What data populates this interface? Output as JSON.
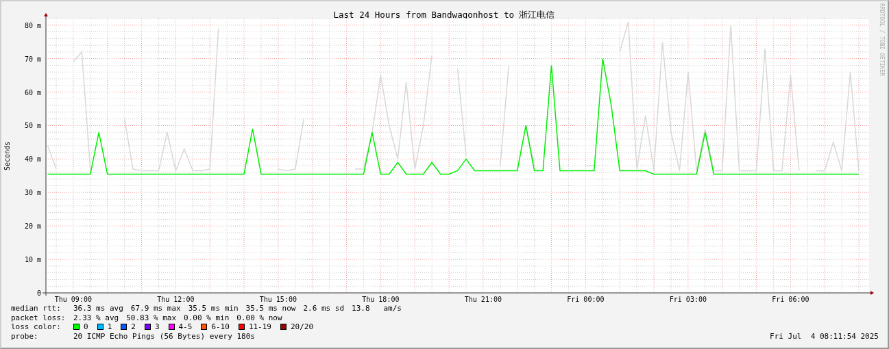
{
  "graph": {
    "title": "Last 24 Hours from Bandwagonhost to 浙江电信",
    "side_note": "RRDTOOL / TOBI OETIKER",
    "chart_data": {
      "type": "line",
      "ylabel": "Seconds",
      "ylim": [
        0,
        82
      ],
      "grid": true,
      "yticks": [
        {
          "value": 0,
          "label": "0"
        },
        {
          "value": 10,
          "label": "10 m"
        },
        {
          "value": 20,
          "label": "20 m"
        },
        {
          "value": 30,
          "label": "30 m"
        },
        {
          "value": 40,
          "label": "40 m"
        },
        {
          "value": 50,
          "label": "50 m"
        },
        {
          "value": 60,
          "label": "60 m"
        },
        {
          "value": 70,
          "label": "70 m"
        },
        {
          "value": 80,
          "label": "80 m"
        }
      ],
      "categories": [
        null,
        null,
        null,
        "Thu 09:00",
        null,
        null,
        null,
        null,
        null,
        null,
        null,
        null,
        null,
        null,
        null,
        "Thu 12:00",
        null,
        null,
        null,
        null,
        null,
        null,
        null,
        null,
        null,
        null,
        null,
        "Thu 15:00",
        null,
        null,
        null,
        null,
        null,
        null,
        null,
        null,
        null,
        null,
        null,
        "Thu 18:00",
        null,
        null,
        null,
        null,
        null,
        null,
        null,
        null,
        null,
        null,
        null,
        "Thu 21:00",
        null,
        null,
        null,
        null,
        null,
        null,
        null,
        null,
        null,
        null,
        null,
        "Fri 00:00",
        null,
        null,
        null,
        null,
        null,
        null,
        null,
        null,
        null,
        null,
        null,
        "Fri 03:00",
        null,
        null,
        null,
        null,
        null,
        null,
        null,
        null,
        null,
        null,
        null,
        "Fri 06:00",
        null,
        null,
        null,
        null,
        null,
        null,
        null,
        null
      ],
      "series": [
        {
          "color": "#d8d8d8",
          "values": [
            44,
            37,
            null,
            69,
            72,
            37,
            null,
            null,
            null,
            52,
            37,
            36.5,
            36.5,
            36.5,
            48,
            36.5,
            43,
            36.5,
            36.5,
            37,
            79,
            null,
            null,
            null,
            null,
            null,
            null,
            37,
            36.5,
            37,
            52,
            null,
            null,
            null,
            null,
            null,
            37,
            37,
            48,
            65,
            50,
            40,
            63,
            37,
            50,
            71,
            null,
            null,
            67,
            41,
            null,
            null,
            null,
            38,
            68,
            null,
            50,
            38,
            null,
            null,
            null,
            null,
            null,
            38,
            38,
            null,
            null,
            72,
            81,
            37,
            53,
            36.5,
            75,
            48,
            36.5,
            66,
            36.5,
            49,
            36.5,
            36.5,
            80,
            36.5,
            36.5,
            36.5,
            73,
            36.5,
            36.5,
            65,
            36.5,
            null,
            36.5,
            36.5,
            45,
            36.5,
            66,
            36.5
          ]
        },
        {
          "color": "#00ee00",
          "values": [
            35.5,
            35.5,
            35.5,
            35.5,
            35.5,
            35.5,
            48,
            35.5,
            35.5,
            35.5,
            35.5,
            35.5,
            35.5,
            35.5,
            35.5,
            35.5,
            35.5,
            35.5,
            35.5,
            35.5,
            35.5,
            35.5,
            35.5,
            35.5,
            49,
            35.5,
            35.5,
            35.5,
            35.5,
            35.5,
            35.5,
            35.5,
            35.5,
            35.5,
            35.5,
            35.5,
            35.5,
            35.5,
            48,
            35.5,
            35.5,
            39,
            35.5,
            35.5,
            35.5,
            39,
            35.5,
            35.5,
            36.5,
            40,
            36.5,
            36.5,
            36.5,
            36.5,
            36.5,
            36.5,
            50,
            36.5,
            36.5,
            68,
            36.5,
            36.5,
            36.5,
            36.5,
            36.5,
            70,
            56,
            36.5,
            36.5,
            36.5,
            36.5,
            35.5,
            35.5,
            35.5,
            35.5,
            35.5,
            35.5,
            48,
            35.5,
            35.5,
            35.5,
            35.5,
            35.5,
            35.5,
            35.5,
            35.5,
            35.5,
            35.5,
            35.5,
            35.5,
            35.5,
            35.5,
            35.5,
            35.5,
            35.5,
            35.5
          ]
        }
      ]
    }
  },
  "legend": {
    "stats": [
      {
        "label": "median rtt:",
        "items": [
          "36.3 ms avg",
          "67.9 ms max",
          "35.5 ms min",
          "35.5 ms now",
          "2.6 ms sd",
          "13.8   am/s"
        ]
      },
      {
        "label": "packet loss:",
        "items": [
          "2.33 % avg",
          "50.83 % max",
          "0.00 % min",
          "0.00 % now"
        ]
      }
    ],
    "loss_label": "loss color:",
    "loss_colors": [
      {
        "label": "0",
        "color": "#00ff00"
      },
      {
        "label": "1",
        "color": "#00b8ff"
      },
      {
        "label": "2",
        "color": "#0059ff"
      },
      {
        "label": "3",
        "color": "#7e00ff"
      },
      {
        "label": "4-5",
        "color": "#ff00ff"
      },
      {
        "label": "6-10",
        "color": "#ff5500"
      },
      {
        "label": "11-19",
        "color": "#ff0000"
      },
      {
        "label": "20/20",
        "color": "#a10000"
      }
    ],
    "probe_label": "probe:",
    "probe": "20 ICMP Echo Pings (56 Bytes) every 180s",
    "timestamp": "Fri Jul  4 08:11:54 2025"
  }
}
